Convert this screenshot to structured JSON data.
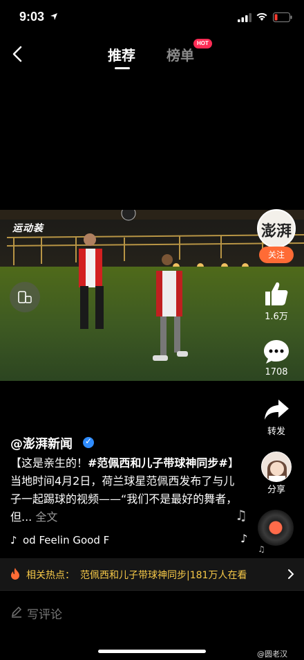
{
  "status_bar": {
    "time": "9:03",
    "icons": [
      "location-arrow-icon",
      "signal-icon",
      "wifi-icon",
      "battery-low-icon"
    ],
    "battery_color": "#ff3b30"
  },
  "nav": {
    "back_icon": "chevron-left-icon",
    "tabs": [
      {
        "label": "推荐",
        "active": true
      },
      {
        "label": "榜单",
        "active": false
      }
    ],
    "hot_badge": "HOT"
  },
  "video": {
    "watermark": "运动装",
    "rotate_icon": "rotate-phone-icon"
  },
  "right_rail": {
    "account_avatar_text": "澎湃",
    "follow_label": "关注",
    "like_count": "1.6万",
    "comment_count": "1708",
    "share_label": "转发",
    "share_friend_label": "分享"
  },
  "caption": {
    "author": "@澎湃新闻",
    "prefix": "【这是亲生的！",
    "hashtag": "#范佩西和儿子带球神同步#",
    "body": "】当地时间4月2日，荷兰球星范佩西发布了与儿子一起踢球的视频——“我们不是最好的舞者，但...",
    "more": "全文"
  },
  "music": {
    "title": "od   Feelin Good   F"
  },
  "hot_topic": {
    "label": "相关热点：",
    "text": "范佩西和儿子带球神同步|181万人在看"
  },
  "comment": {
    "placeholder": "写评论"
  },
  "watermark": "@圆老汉",
  "colors": {
    "accent_orange": "#ff6b35",
    "hot_yellow": "#f7c948",
    "badge_red": "#fe2c55"
  }
}
